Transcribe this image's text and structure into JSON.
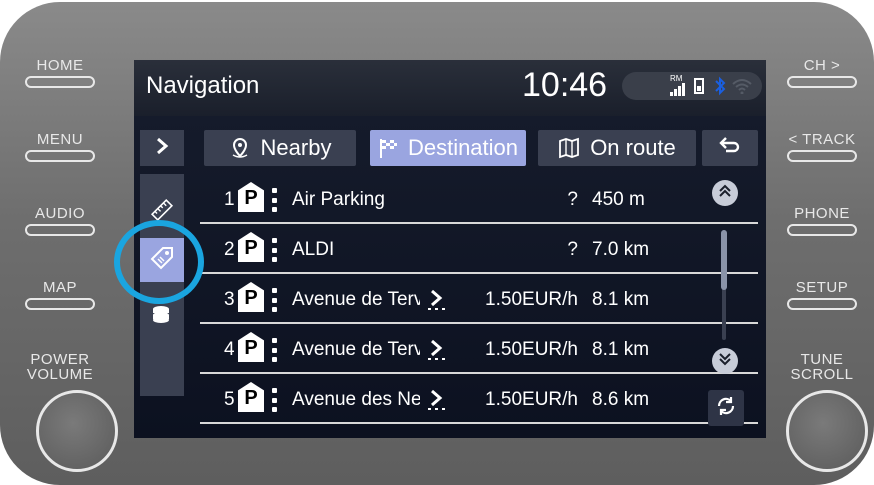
{
  "hardkeys": {
    "home": "HOME",
    "menu": "MENU",
    "audio": "AUDIO",
    "map": "MAP",
    "power_line1": "POWER",
    "power_line2": "VOLUME",
    "ch": "CH >",
    "track": "< TRACK",
    "phone": "PHONE",
    "setup": "SETUP",
    "tune_line1": "TUNE",
    "tune_line2": "SCROLL"
  },
  "header": {
    "title": "Navigation",
    "clock": "10:46",
    "rm_badge": "RM"
  },
  "tabs": [
    {
      "label": "Nearby",
      "icon": "map-pin-icon",
      "selected": false
    },
    {
      "label": "Destination",
      "icon": "checkered-flag-icon",
      "selected": true
    },
    {
      "label": "On route",
      "icon": "route-map-icon",
      "selected": false
    }
  ],
  "results": [
    {
      "index": "1",
      "name": "Air Parking",
      "price": "?",
      "distance": "450 m",
      "has_arrow": false
    },
    {
      "index": "2",
      "name": "ALDI",
      "price": "?",
      "distance": "7.0 km",
      "has_arrow": false
    },
    {
      "index": "3",
      "name": "Avenue de Tervuren",
      "name_shown": "Avenue de Terv",
      "price": "1.50EUR/h",
      "distance": "8.1 km",
      "has_arrow": true
    },
    {
      "index": "4",
      "name": "Avenue de Tervuren",
      "name_shown": "Avenue de Terv",
      "price": "1.50EUR/h",
      "distance": "8.1 km",
      "has_arrow": true
    },
    {
      "index": "5",
      "name": "Avenue des Nerviens",
      "name_shown": "Avenue des Ne",
      "price": "1.50EUR/h",
      "distance": "8.6 km",
      "has_arrow": true
    }
  ],
  "colors": {
    "accent": "#1aa5e0",
    "selected_tab": "#9aa5e0",
    "unselected_tab": "#3a4051"
  }
}
